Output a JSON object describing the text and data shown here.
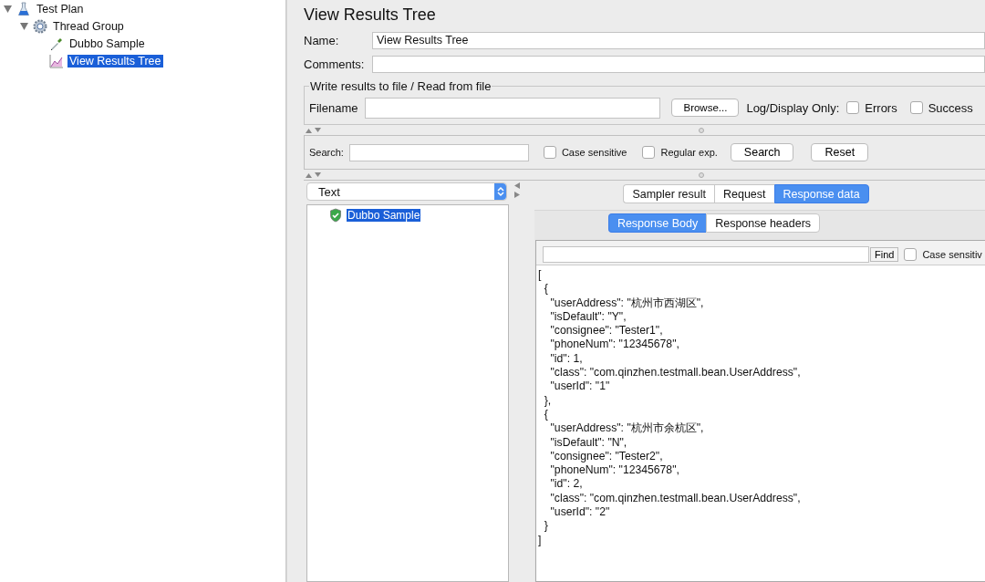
{
  "tree": [
    {
      "label": "Test Plan",
      "kind": "plan",
      "expanded": true,
      "selected": false,
      "children": [
        {
          "label": "Thread Group",
          "kind": "threads",
          "expanded": true,
          "selected": false,
          "children": [
            {
              "label": "Dubbo Sample",
              "kind": "sampler",
              "selected": false
            },
            {
              "label": "View Results Tree",
              "kind": "listener",
              "selected": true
            }
          ]
        }
      ]
    }
  ],
  "title": "View Results Tree",
  "name_field": {
    "label": "Name:",
    "value": "View Results Tree"
  },
  "comments_field": {
    "label": "Comments:"
  },
  "file_group": {
    "legend": "Write results to file / Read from file",
    "filename_label": "Filename",
    "browse_button": "Browse...",
    "log_label": "Log/Display Only:",
    "checkboxes": [
      {
        "label": "Errors",
        "checked": false
      },
      {
        "label": "Success",
        "checked": false
      }
    ]
  },
  "search_bar": {
    "label": "Search:",
    "options": [
      {
        "label": "Case sensitive",
        "checked": false
      },
      {
        "label": "Regular exp.",
        "checked": false
      }
    ],
    "buttons": [
      "Search",
      "Reset"
    ]
  },
  "renderer": {
    "value": "Text"
  },
  "results": [
    {
      "label": "Dubbo Sample",
      "selected": true
    }
  ],
  "tabs": [
    {
      "label": "Sampler result",
      "selected": false
    },
    {
      "label": "Request",
      "selected": false
    },
    {
      "label": "Response data",
      "selected": true
    }
  ],
  "subtabs": [
    {
      "label": "Response Body",
      "selected": true
    },
    {
      "label": "Response headers",
      "selected": false
    }
  ],
  "find_bar": {
    "button": "Find",
    "option": {
      "label": "Case sensitiv",
      "checked": false
    }
  },
  "response_lines": [
    "[",
    "  {",
    "    \"userAddress\": \"杭州市西湖区\",",
    "    \"isDefault\": \"Y\",",
    "    \"consignee\": \"Tester1\",",
    "    \"phoneNum\": \"12345678\",",
    "    \"id\": 1,",
    "    \"class\": \"com.qinzhen.testmall.bean.UserAddress\",",
    "    \"userId\": \"1\"",
    "  },",
    "  {",
    "    \"userAddress\": \"杭州市余杭区\",",
    "    \"isDefault\": \"N\",",
    "    \"consignee\": \"Tester2\",",
    "    \"phoneNum\": \"12345678\",",
    "    \"id\": 2,",
    "    \"class\": \"com.qinzhen.testmall.bean.UserAddress\",",
    "    \"userId\": \"2\"",
    "  }",
    "]"
  ]
}
